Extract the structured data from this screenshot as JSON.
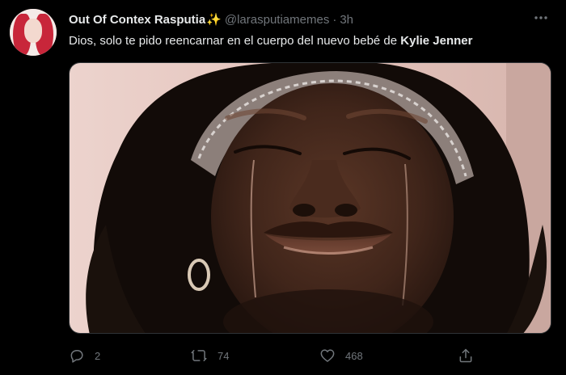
{
  "tweet": {
    "display_name": "Out Of Contex Rasputia",
    "name_emoji": "✨",
    "handle": "@larasputiamemes",
    "separator": "·",
    "time": "3h",
    "more_icon": "more-horizontal-icon",
    "text_prefix": "Dios, solo te pido reencarnar en el cuerpo del nuevo bebé de ",
    "text_bold": "Kylie Jenner",
    "media": {
      "type": "photo",
      "accent_colors": [
        "#e8cfc9",
        "#3a2218",
        "#0f0a08"
      ]
    },
    "actions": {
      "reply": {
        "icon": "reply-icon",
        "count": "2"
      },
      "retweet": {
        "icon": "retweet-icon",
        "count": "74"
      },
      "like": {
        "icon": "heart-icon",
        "count": "468"
      },
      "share": {
        "icon": "share-icon"
      }
    }
  },
  "colors": {
    "background": "#000000",
    "text_primary": "#e7e9ea",
    "text_secondary": "#71767b"
  }
}
